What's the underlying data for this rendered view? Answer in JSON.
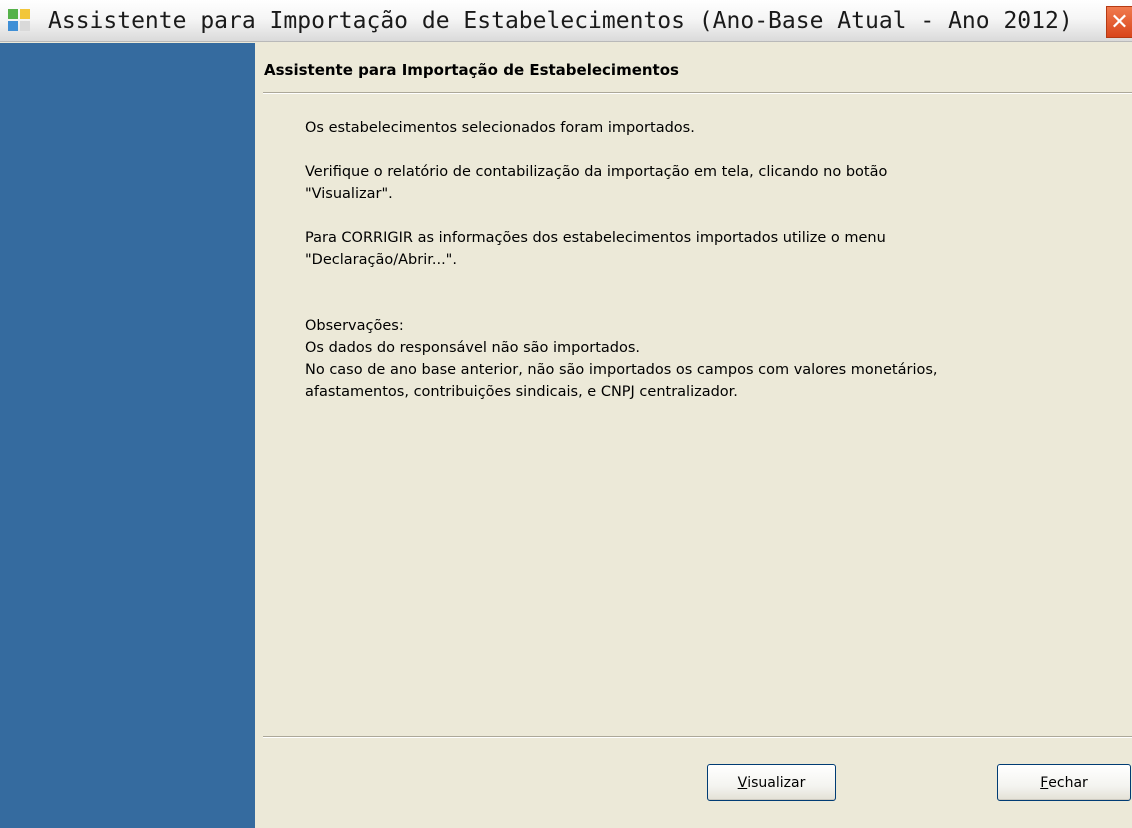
{
  "window": {
    "title": "Assistente para Importação de Estabelecimentos (Ano-Base Atual - Ano 2012)",
    "close_label": "✕"
  },
  "wizard": {
    "header": "Assistente para Importação de Estabelecimentos",
    "paragraphs": {
      "p1": "Os estabelecimentos selecionados foram importados.",
      "p2a": "Verifique o relatório de contabilização da importação em tela, clicando no botão",
      "p2b": "\"Visualizar\".",
      "p3a": "Para CORRIGIR as informações dos estabelecimentos importados utilize o menu",
      "p3b": "\"Declaração/Abrir...\".",
      "obs_title": "Observações:",
      "obs1": "Os dados do responsável não são importados.",
      "obs2a": "No caso de ano base anterior, não são importados os campos com valores monetários,",
      "obs2b": "afastamentos, contribuições sindicais, e CNPJ centralizador."
    }
  },
  "buttons": {
    "visualizar_first": "V",
    "visualizar_rest": "isualizar",
    "fechar_first": "F",
    "fechar_rest": "echar"
  },
  "colors": {
    "side_panel": "#356b9f",
    "dialog_bg": "#ece9d8",
    "close_button": "#e05a2a"
  }
}
